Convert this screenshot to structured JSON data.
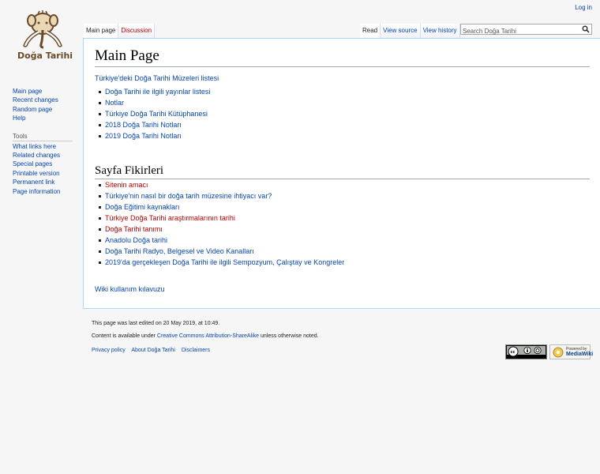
{
  "site": {
    "logo_text": "Doğa Tarihi",
    "login": "Log in"
  },
  "tabs_left": [
    {
      "label": "Main page",
      "state": "selected"
    },
    {
      "label": "Discussion",
      "state": "new"
    }
  ],
  "tabs_right": [
    {
      "label": "Read",
      "state": "selected"
    },
    {
      "label": "View source",
      "state": "normal"
    },
    {
      "label": "View history",
      "state": "normal"
    }
  ],
  "search": {
    "placeholder": "Search Doğa Tarihi",
    "button_icon": "search-icon"
  },
  "sidebar": {
    "navigation": [
      "Main page",
      "Recent changes",
      "Random page",
      "Help"
    ],
    "tools_heading": "Tools",
    "tools": [
      "What links here",
      "Related changes",
      "Special pages",
      "Printable version",
      "Permanent link",
      "Page information"
    ]
  },
  "content": {
    "title": "Main Page",
    "intro_link": "Türkiye'deki Doğa Tarihi Müzeleri listesi",
    "list1": [
      {
        "label": "Doğa Tarihi ile ilgili yayınlar listesi",
        "new": false
      },
      {
        "label": "Notlar",
        "new": false
      },
      {
        "label": "Türkiye Doğa Tarihi Kütüphanesi",
        "new": false
      },
      {
        "label": "2018 Doğa Tarihi Notları",
        "new": false
      },
      {
        "label": "2019 Doğa Tarihi Notları",
        "new": false
      }
    ],
    "section_title": "Sayfa Fikirleri",
    "list2": [
      {
        "label": "Sitenin amacı",
        "new": true
      },
      {
        "label": "Türkiye'nin nasıl bir doğa tarih müzesine ihtiyacı var?",
        "new": false
      },
      {
        "label": "Doğa Eğitimi kaynakları",
        "new": false
      },
      {
        "label": "Türkiye Doğa Tarihi araştırmalarının tarihi",
        "new": true
      },
      {
        "label": "Doğa Tarihi tanımı",
        "new": true
      },
      {
        "label": "Anadolu Doğa tarihi",
        "new": false
      },
      {
        "label": "Doğa Tarihi Radyo, Belgesel ve Video Kanalları",
        "new": false
      },
      {
        "label": "2019'da gerçekleşen Doğa Tarihi ile ilgili Sempozyum, Çalıştay ve Kongreler",
        "new": false
      }
    ],
    "guide_link": "Wiki kullanım kılavuzu"
  },
  "footer": {
    "last_edited": "This page was last edited on 20 May 2019, at 10:49.",
    "license_prefix": "Content is available under ",
    "license_link": "Creative Commons Attribution-ShareAlike",
    "license_suffix": " unless otherwise noted.",
    "places": [
      "Privacy policy",
      "About Doğa Tarihi",
      "Disclaimers"
    ],
    "mw_badge_line1": "Powered by",
    "mw_badge_line2": "MediaWiki"
  },
  "colors": {
    "link": "#0645ad",
    "new_link": "#ba0000",
    "logo_brown": "#6b4a2a",
    "content_border": "#a7d7f9"
  }
}
